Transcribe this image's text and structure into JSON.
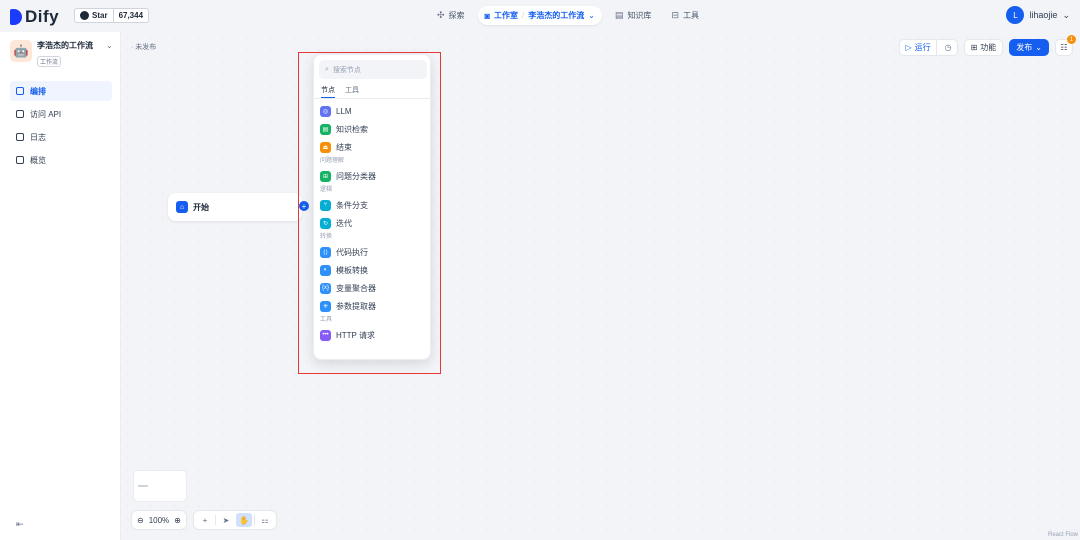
{
  "brand": {
    "name": "Dify"
  },
  "github": {
    "star_label": "Star",
    "stars": "67,344"
  },
  "nav": {
    "explore": "探索",
    "studio": "工作室",
    "studio_app": "李浩杰的工作流",
    "knowledge": "知识库",
    "tools": "工具"
  },
  "user": {
    "initial": "L",
    "name": "lihaojie"
  },
  "app": {
    "name": "李浩杰的工作流",
    "type": "工作流"
  },
  "sidebar": {
    "items": [
      {
        "label": "编排",
        "active": true
      },
      {
        "label": "访问 API",
        "active": false
      },
      {
        "label": "日志",
        "active": false
      },
      {
        "label": "概览",
        "active": false
      }
    ]
  },
  "canvas": {
    "status": "· 未发布"
  },
  "toolbar": {
    "run": "运行",
    "features": "功能",
    "publish": "发布",
    "checklist_count": "1"
  },
  "start_node": {
    "label": "开始"
  },
  "picker": {
    "search_placeholder": "搜索节点",
    "tabs": [
      "节点",
      "工具"
    ],
    "items": [
      {
        "label": "LLM",
        "color": "#6172f3",
        "glyph": "◎"
      },
      {
        "label": "知识检索",
        "color": "#16b364",
        "glyph": "▤"
      },
      {
        "label": "结束",
        "color": "#f79009",
        "glyph": "⏏"
      }
    ],
    "group_qa": "问题理解",
    "qa_items": [
      {
        "label": "问题分类器",
        "color": "#16b364",
        "glyph": "⊞"
      }
    ],
    "group_logic": "逻辑",
    "logic_items": [
      {
        "label": "条件分支",
        "color": "#06aed4",
        "glyph": "⑂"
      },
      {
        "label": "迭代",
        "color": "#06aed4",
        "glyph": "↻"
      }
    ],
    "group_transform": "转换",
    "transform_items": [
      {
        "label": "代码执行",
        "color": "#2e90fa",
        "glyph": "⟨⟩"
      },
      {
        "label": "模板转换",
        "color": "#2e90fa",
        "glyph": "◐"
      },
      {
        "label": "变量聚合器",
        "color": "#2e90fa",
        "glyph": "{x}"
      },
      {
        "label": "参数提取器",
        "color": "#2e90fa",
        "glyph": "✳"
      }
    ],
    "group_tools": "工具",
    "tool_items": [
      {
        "label": "HTTP 请求",
        "color": "#875bf7",
        "glyph": "•••"
      }
    ]
  },
  "zoom": {
    "level": "100%"
  },
  "footer": {
    "reactflow": "React Flow"
  }
}
